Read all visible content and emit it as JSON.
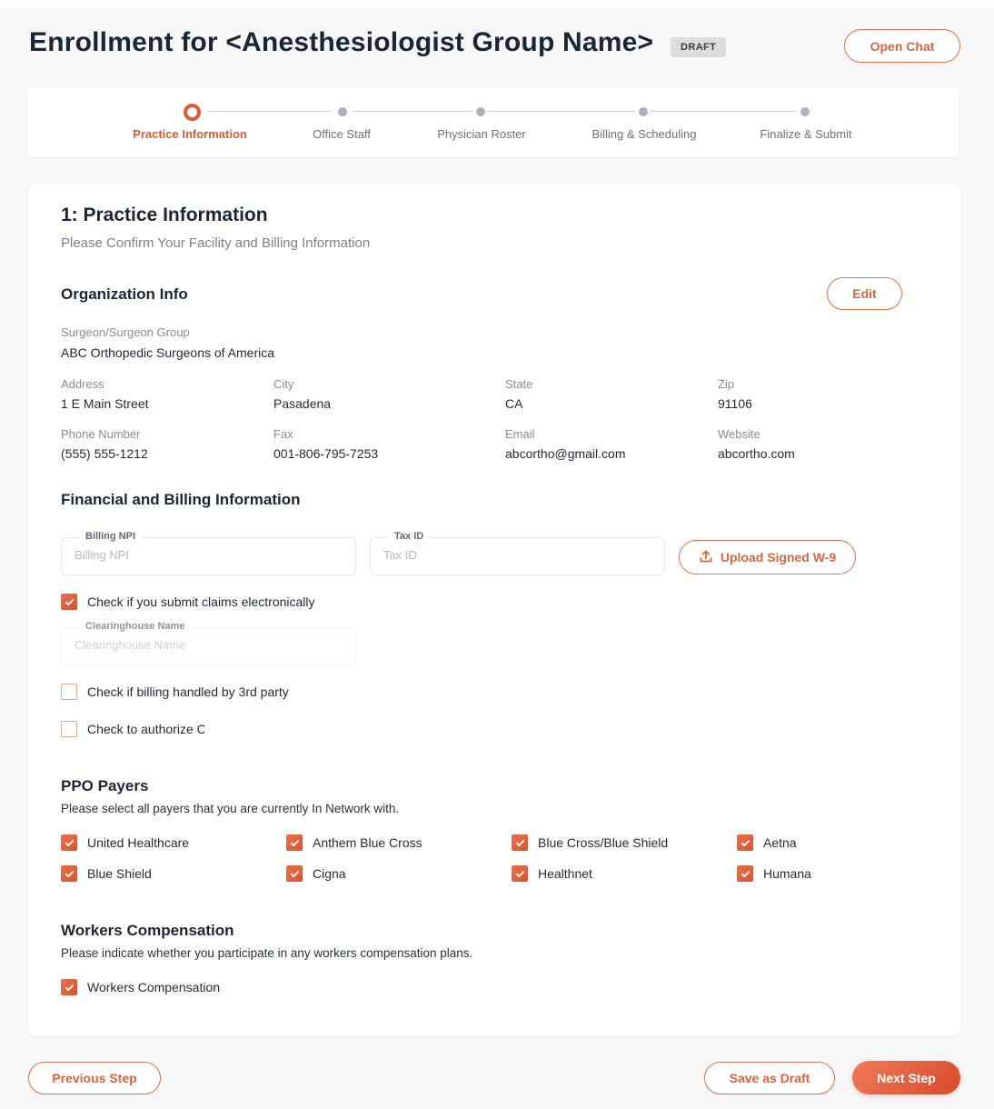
{
  "header": {
    "title": "Enrollment for <Anesthesiologist Group Name>",
    "status_badge": "DRAFT",
    "open_chat_label": "Open Chat"
  },
  "stepper": {
    "active_index": 0,
    "steps": [
      {
        "label": "Practice Information"
      },
      {
        "label": "Office Staff"
      },
      {
        "label": "Physician Roster"
      },
      {
        "label": "Billing & Scheduling"
      },
      {
        "label": "Finalize & Submit"
      }
    ]
  },
  "section": {
    "title": "1: Practice Information",
    "subtitle": "Please Confirm Your Facility and Billing Information"
  },
  "organization": {
    "title": "Organization Info",
    "edit_label": "Edit",
    "surgeon_group": {
      "label": "Surgeon/Surgeon Group",
      "value": "ABC Orthopedic Surgeons of America"
    },
    "address": {
      "label": "Address",
      "value": "1 E Main Street"
    },
    "city": {
      "label": "City",
      "value": "Pasadena"
    },
    "state": {
      "label": "State",
      "value": "CA"
    },
    "zip": {
      "label": "Zip",
      "value": "91106"
    },
    "phone": {
      "label": "Phone Number",
      "value": "(555) 555-1212"
    },
    "fax": {
      "label": "Fax",
      "value": "001-806-795-7253"
    },
    "email": {
      "label": "Email",
      "value": "abcortho@gmail.com"
    },
    "website": {
      "label": "Website",
      "value": "abcortho.com"
    }
  },
  "financial": {
    "title": "Financial and Billing Information",
    "billing_npi": {
      "label": "Billing NPI",
      "placeholder": "Billing NPI",
      "value": ""
    },
    "tax_id": {
      "label": "Tax ID",
      "placeholder": "Tax ID",
      "value": ""
    },
    "upload_label": "Upload Signed W-9",
    "electronic_claims": {
      "label": "Check if you submit claims electronically",
      "checked": true
    },
    "clearinghouse": {
      "label": "Clearinghouse Name",
      "placeholder": "Clearinghouse Name",
      "value": ""
    },
    "third_party": {
      "label": "Check if billing handled by 3rd party",
      "checked": false
    },
    "authorize": {
      "label": "Check to authorize C",
      "checked": false
    }
  },
  "ppo": {
    "title": "PPO Payers",
    "description": "Please select all payers that you are currently In Network with.",
    "payers": [
      {
        "label": "United Healthcare",
        "checked": true
      },
      {
        "label": "Anthem Blue Cross",
        "checked": true
      },
      {
        "label": "Blue Cross/Blue Shield",
        "checked": true
      },
      {
        "label": "Aetna",
        "checked": true
      },
      {
        "label": "Blue Shield",
        "checked": true
      },
      {
        "label": "Cigna",
        "checked": true
      },
      {
        "label": "Healthnet",
        "checked": true
      },
      {
        "label": "Humana",
        "checked": true
      }
    ]
  },
  "workers_comp": {
    "title": "Workers Compensation",
    "description": "Please indicate whether you participate in any workers compensation plans.",
    "option": {
      "label": "Workers Compensation",
      "checked": true
    }
  },
  "footer": {
    "previous_label": "Previous Step",
    "save_draft_label": "Save as Draft",
    "next_label": "Next Step"
  },
  "colors": {
    "accent": "#dc5a36",
    "step_inactive": "#aab3bd",
    "heading": "#1a2633"
  }
}
